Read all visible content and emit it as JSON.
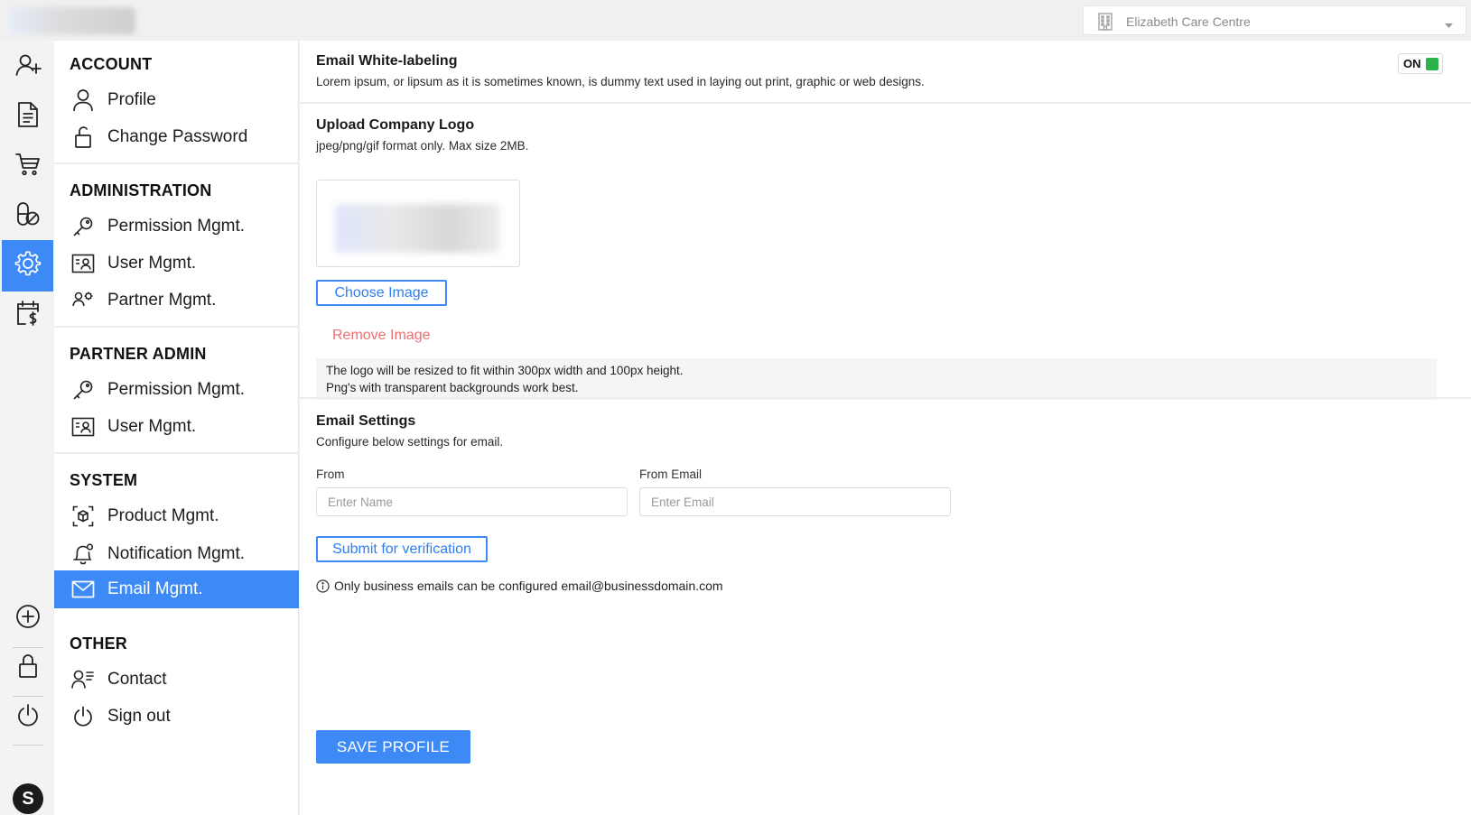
{
  "header": {
    "facility_selector": {
      "value": "Elizabeth Care Centre",
      "icon": "building-icon",
      "caret": "chevron-down-icon"
    }
  },
  "rail": {
    "items": [
      {
        "name": "add-user",
        "icon": "user-plus-icon"
      },
      {
        "name": "documents",
        "icon": "document-icon"
      },
      {
        "name": "cart",
        "icon": "cart-icon"
      },
      {
        "name": "pills",
        "icon": "pills-icon"
      },
      {
        "name": "settings",
        "icon": "gear-icon",
        "active": true
      },
      {
        "name": "billing",
        "icon": "calendar-dollar-icon"
      },
      {
        "name": "add",
        "icon": "plus-circle-icon"
      },
      {
        "name": "lock",
        "icon": "lock-icon"
      },
      {
        "name": "power",
        "icon": "power-icon"
      }
    ],
    "avatar_letter": "S"
  },
  "menu": {
    "account": {
      "heading": "ACCOUNT",
      "items": [
        {
          "label": "Profile",
          "icon": "user-icon"
        },
        {
          "label": "Change Password",
          "icon": "unlock-icon"
        }
      ]
    },
    "administration": {
      "heading": "ADMINISTRATION",
      "items": [
        {
          "label": "Permission Mgmt.",
          "icon": "key-icon"
        },
        {
          "label": "User Mgmt.",
          "icon": "id-card-icon"
        },
        {
          "label": "Partner Mgmt.",
          "icon": "partner-icon"
        }
      ]
    },
    "partner_admin": {
      "heading": "PARTNER ADMIN",
      "items": [
        {
          "label": "Permission Mgmt.",
          "icon": "key-icon"
        },
        {
          "label": "User Mgmt.",
          "icon": "id-card-icon"
        }
      ]
    },
    "system": {
      "heading": "SYSTEM",
      "items": [
        {
          "label": "Product Mgmt.",
          "icon": "product-scan-icon"
        },
        {
          "label": "Notification Mgmt.",
          "icon": "bell-icon"
        },
        {
          "label": "Email Mgmt.",
          "icon": "mail-icon",
          "active": true
        }
      ]
    },
    "other": {
      "heading": "OTHER",
      "items": [
        {
          "label": "Contact",
          "icon": "contact-icon"
        },
        {
          "label": "Sign out",
          "icon": "power-icon"
        }
      ]
    }
  },
  "content": {
    "white_label": {
      "title": "Email White-labeling",
      "description": "Lorem ipsum, or lipsum as it is sometimes known, is dummy text used in laying out print, graphic or web designs.",
      "toggle_label": "ON",
      "toggle_color": "#2bb34a"
    },
    "logo": {
      "title": "Upload Company Logo",
      "hint": "jpeg/png/gif format only. Max size 2MB.",
      "choose_label": "Choose Image",
      "remove_label": "Remove Image",
      "note_line1": "The logo will be resized to fit within 300px width and 100px height.",
      "note_line2": "Png's with transparent backgrounds work best."
    },
    "email_settings": {
      "title": "Email Settings",
      "description": "Configure below settings for email.",
      "from_label": "From",
      "from_placeholder": "Enter Name",
      "from_value": "",
      "from_email_label": "From Email",
      "from_email_placeholder": "Enter Email",
      "from_email_value": "",
      "submit_label": "Submit for verification",
      "info_text": "Only business emails can be configured email@businessdomain.com"
    },
    "save_label": "SAVE PROFILE"
  },
  "colors": {
    "accent": "#3d8af7",
    "danger_link": "#f07070",
    "toggle_on": "#2bb34a"
  }
}
